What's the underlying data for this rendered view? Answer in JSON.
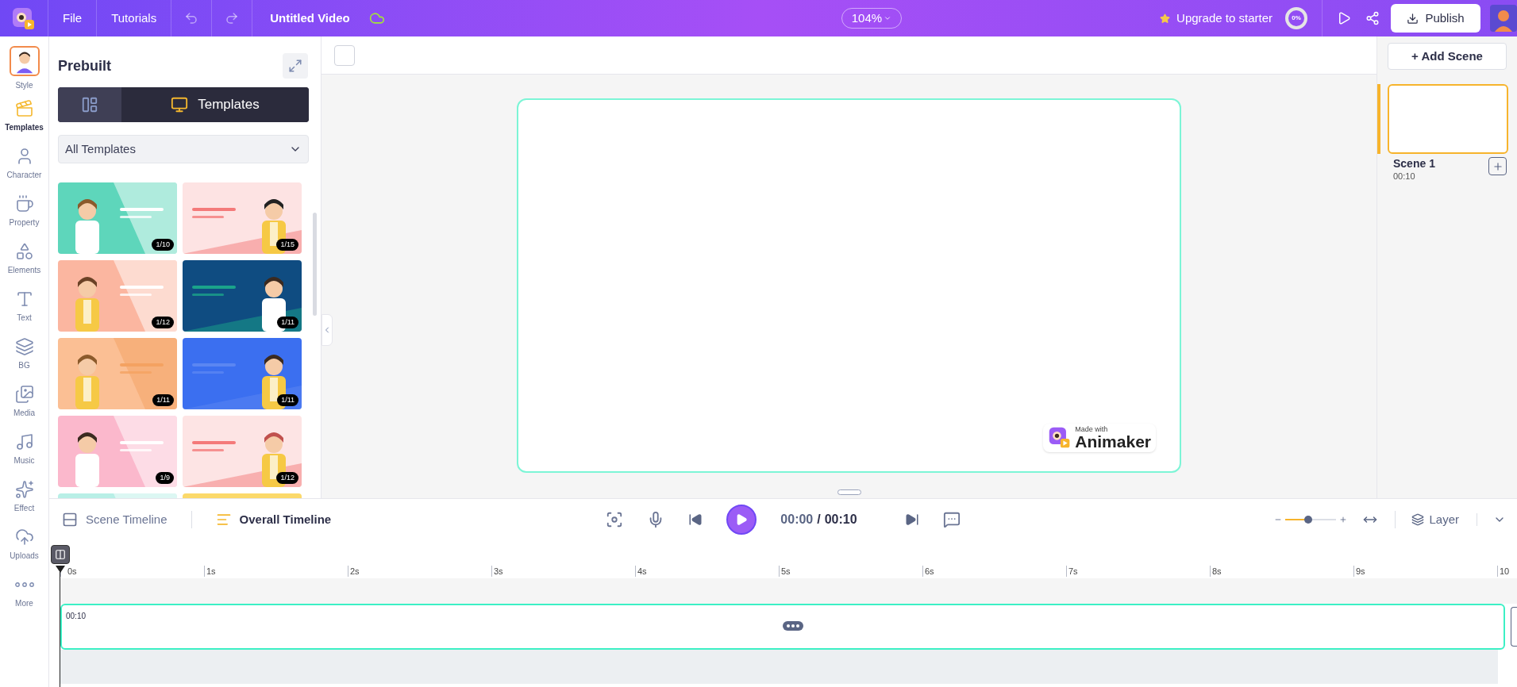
{
  "top_bar": {
    "menu": [
      {
        "label": "File"
      },
      {
        "label": "Tutorials"
      }
    ],
    "project_title": "Untitled Video",
    "zoom": "104%",
    "upgrade": "Upgrade to starter",
    "progress": "0%",
    "publish": "Publish"
  },
  "sidebar": {
    "items": [
      {
        "label": "Style",
        "kind": "avatar",
        "selected": false
      },
      {
        "label": "Templates",
        "kind": "templates",
        "selected": true
      },
      {
        "label": "Character",
        "kind": "character",
        "selected": false
      },
      {
        "label": "Property",
        "kind": "property",
        "selected": false
      },
      {
        "label": "Elements",
        "kind": "elements",
        "selected": false
      },
      {
        "label": "Text",
        "kind": "text",
        "selected": false
      },
      {
        "label": "BG",
        "kind": "bg",
        "selected": false
      },
      {
        "label": "Media",
        "kind": "media",
        "selected": false
      },
      {
        "label": "Music",
        "kind": "music",
        "selected": false
      },
      {
        "label": "Effect",
        "kind": "effect",
        "selected": false
      },
      {
        "label": "Uploads",
        "kind": "uploads",
        "selected": false
      },
      {
        "label": "More",
        "kind": "more",
        "selected": false
      }
    ]
  },
  "panel": {
    "title": "Prebuilt",
    "tabs": [
      {
        "kind": "layout",
        "selected": false
      },
      {
        "kind": "templates",
        "label": "Templates",
        "selected": true
      }
    ],
    "filter": "All Templates",
    "templates": [
      {
        "kind": "picture",
        "count": "1/10"
      },
      {
        "kind": "picture",
        "count": "1/15"
      },
      {
        "kind": "picture",
        "count": "1/12"
      },
      {
        "kind": "picture",
        "count": "1/11"
      },
      {
        "kind": "picture",
        "count": "1/11"
      },
      {
        "kind": "picture",
        "count": "1/11"
      },
      {
        "kind": "picture",
        "count": "1/9"
      },
      {
        "kind": "picture",
        "count": "1/12"
      },
      {
        "kind": "picture"
      },
      {
        "kind": "picture"
      }
    ]
  },
  "canvas": {
    "select_checked": false,
    "watermark_caption": "Made with",
    "watermark_brand": "Animaker"
  },
  "scenes_panel": {
    "add_scene": "+ Add Scene",
    "scenes": [
      {
        "name": "Scene 1",
        "duration": "00:10",
        "selected": true
      }
    ]
  },
  "timeline": {
    "tabs": [
      {
        "label": "Scene Timeline",
        "kind": "scene",
        "selected": false
      },
      {
        "label": "Overall Timeline",
        "kind": "overall",
        "selected": true
      }
    ],
    "current_time": "00:00",
    "separator": "/",
    "total_time": "00:10",
    "zoom": {
      "level": 0.45
    },
    "layer": "Layer",
    "ticks": [
      "0s",
      "1s",
      "2s",
      "3s",
      "4s",
      "5s",
      "6s",
      "7s",
      "8s",
      "9s",
      "10"
    ],
    "clip_duration": "00:10"
  }
}
